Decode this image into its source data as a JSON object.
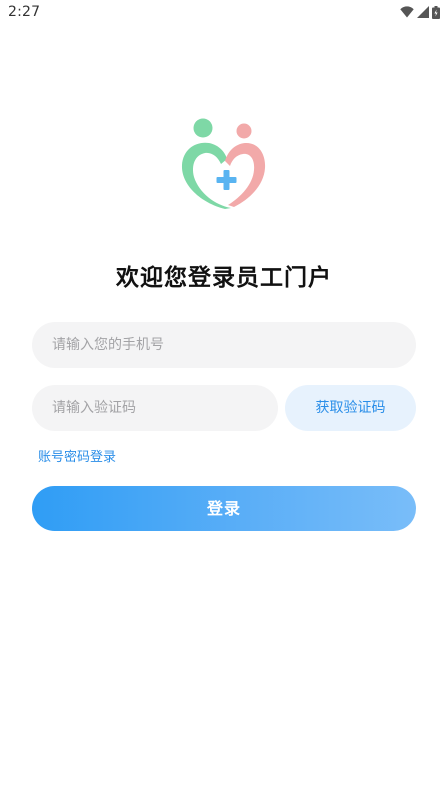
{
  "status_bar": {
    "time": "2:27",
    "icons": [
      "wifi-icon",
      "cellular-signal-icon",
      "battery-icon"
    ]
  },
  "logo": {
    "name": "heart-medical-cross-logo",
    "colors": {
      "green": "#7ed8a6",
      "pink": "#f2a9a9",
      "cross": "#59b4f1"
    }
  },
  "title": "欢迎您登录员工门户",
  "phone_input": {
    "placeholder": "请输入您的手机号",
    "value": ""
  },
  "code_input": {
    "placeholder": "请输入验证码",
    "value": ""
  },
  "get_code_button": {
    "label": "获取验证码"
  },
  "password_login_link": {
    "label": "账号密码登录"
  },
  "login_button": {
    "label": "登录"
  },
  "colors": {
    "accent": "#2a8ee8",
    "input_background": "#f4f4f5",
    "code_button_background": "#e7f2fd"
  }
}
